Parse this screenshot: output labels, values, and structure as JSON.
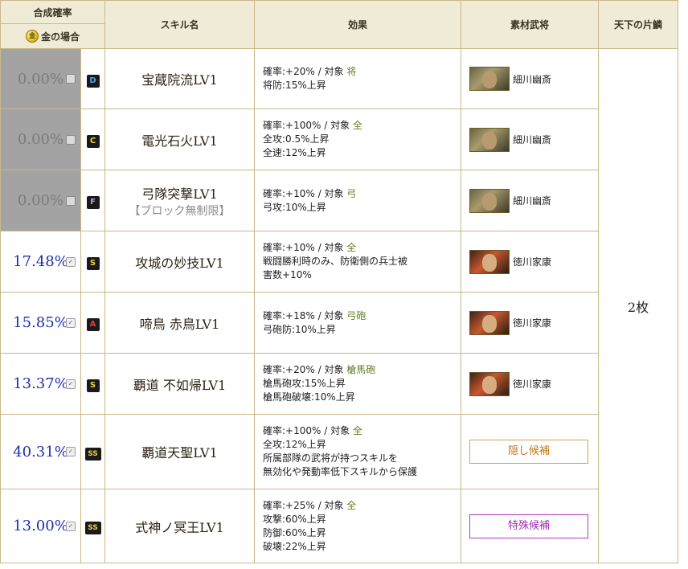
{
  "headers": {
    "rate": "合成確率",
    "gold_case": "金の場合",
    "coin_glyph": "金",
    "skill_name": "スキル名",
    "effect": "効果",
    "material": "素材武将",
    "tenka": "天下の片鱗"
  },
  "tenka_value": "2枚",
  "rank_colors": {
    "D": "#4aa8e8",
    "C": "#e8d24a",
    "F": "#b89ce0",
    "S": "#f0d040",
    "A": "#e83c3c",
    "SS": "#f0d040"
  },
  "rows": [
    {
      "rate": "0.00%",
      "checked": false,
      "rank": "D",
      "name": "宝蔵院流LV1",
      "sub": "",
      "effect": [
        {
          "a": "確率:+20% / 対象 ",
          "t": "将"
        },
        {
          "a": "将防:15%上昇"
        }
      ],
      "material": {
        "kind": "officer",
        "face": "hosokawa",
        "name": "細川幽斎"
      }
    },
    {
      "rate": "0.00%",
      "checked": false,
      "rank": "C",
      "name": "電光石火LV1",
      "sub": "",
      "effect": [
        {
          "a": "確率:+100% / 対象 ",
          "t": "全"
        },
        {
          "a": "全攻:0.5%上昇"
        },
        {
          "a": "全速:12%上昇"
        }
      ],
      "material": {
        "kind": "officer",
        "face": "hosokawa",
        "name": "細川幽斎"
      }
    },
    {
      "rate": "0.00%",
      "checked": false,
      "rank": "F",
      "name": "弓隊突撃LV1",
      "sub": "【ブロック無制限】",
      "effect": [
        {
          "a": "確率:+10% / 対象 ",
          "t": "弓"
        },
        {
          "a": "弓攻:10%上昇"
        }
      ],
      "material": {
        "kind": "officer",
        "face": "hosokawa",
        "name": "細川幽斎"
      }
    },
    {
      "rate": "17.48%",
      "checked": true,
      "rank": "S",
      "name": "攻城の妙技LV1",
      "sub": "",
      "effect": [
        {
          "a": "確率:+10% / 対象 ",
          "t": "全"
        },
        {
          "a": "戦闘勝利時のみ、防衛側の兵士被"
        },
        {
          "a": "害数+10%"
        }
      ],
      "material": {
        "kind": "officer",
        "face": "tokugawa",
        "name": "徳川家康"
      }
    },
    {
      "rate": "15.85%",
      "checked": true,
      "rank": "A",
      "name": "啼鳥 赤鳥LV1",
      "sub": "",
      "effect": [
        {
          "a": "確率:+18% / 対象 ",
          "t": "弓砲"
        },
        {
          "a": "弓砲防:10%上昇"
        }
      ],
      "material": {
        "kind": "officer",
        "face": "tokugawa",
        "name": "徳川家康"
      }
    },
    {
      "rate": "13.37%",
      "checked": true,
      "rank": "S",
      "name": "覇道 不如帰LV1",
      "sub": "",
      "effect": [
        {
          "a": "確率:+20% / 対象 ",
          "t": "槍馬砲"
        },
        {
          "a": "槍馬砲攻:15%上昇"
        },
        {
          "a": "槍馬砲破壊:10%上昇"
        }
      ],
      "material": {
        "kind": "officer",
        "face": "tokugawa",
        "name": "徳川家康"
      }
    },
    {
      "rate": "40.31%",
      "checked": true,
      "rank": "SS",
      "name": "覇道天聖LV1",
      "sub": "",
      "effect": [
        {
          "a": "確率:+100% / 対象 ",
          "t": "全"
        },
        {
          "a": "全攻:12%上昇"
        },
        {
          "a": "所属部隊の武将が持つスキルを"
        },
        {
          "a": "無効化や発動率低下スキルから保護"
        }
      ],
      "material": {
        "kind": "button",
        "style": "hidden",
        "label": "隠し候補"
      }
    },
    {
      "rate": "13.00%",
      "checked": true,
      "rank": "SS",
      "name": "式神ノ冥王LV1",
      "sub": "",
      "effect": [
        {
          "a": "確率:+25% / 対象 ",
          "t": "全"
        },
        {
          "a": "攻撃:60%上昇"
        },
        {
          "a": "防御:60%上昇"
        },
        {
          "a": "破壊:22%上昇"
        }
      ],
      "material": {
        "kind": "button",
        "style": "special",
        "label": "特殊候補"
      }
    }
  ]
}
